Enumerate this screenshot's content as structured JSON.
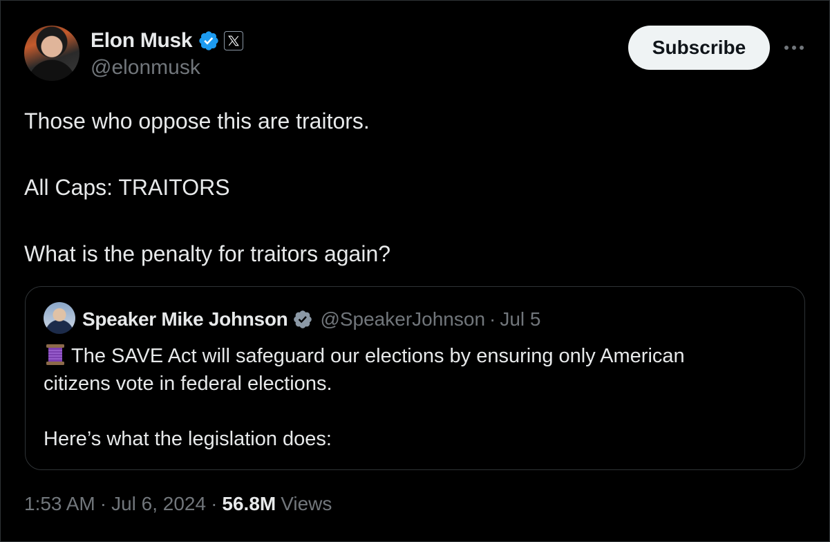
{
  "author": {
    "display_name": "Elon Musk",
    "handle": "@elonmusk",
    "verified_icon": "verified-badge-icon",
    "affiliation_icon": "x-logo-icon"
  },
  "actions": {
    "subscribe_label": "Subscribe",
    "more_label": "•••"
  },
  "tweet": {
    "line1": "Those who oppose this are traitors.",
    "line2": "All Caps: TRAITORS",
    "line3": "What is the penalty for traitors again?"
  },
  "quoted_tweet": {
    "display_name": "Speaker Mike Johnson",
    "handle": "@SpeakerJohnson",
    "separator": "·",
    "date": "Jul 5",
    "emoji_icon": "thread-spool-icon",
    "line1": "The SAVE Act will safeguard our elections by ensuring only American",
    "line2": "citizens vote in federal elections.",
    "line3": "Here’s what the legislation does:"
  },
  "meta": {
    "time": "1:53 AM",
    "separator": "·",
    "date": "Jul 6, 2024",
    "views_count": "56.8M",
    "views_label": "Views"
  },
  "colors": {
    "background": "#000000",
    "primary_text": "#e7e9ea",
    "secondary_text": "#71767b",
    "border": "#2f3336",
    "verified_blue": "#1d9bf0",
    "button_bg": "#eff3f4"
  }
}
